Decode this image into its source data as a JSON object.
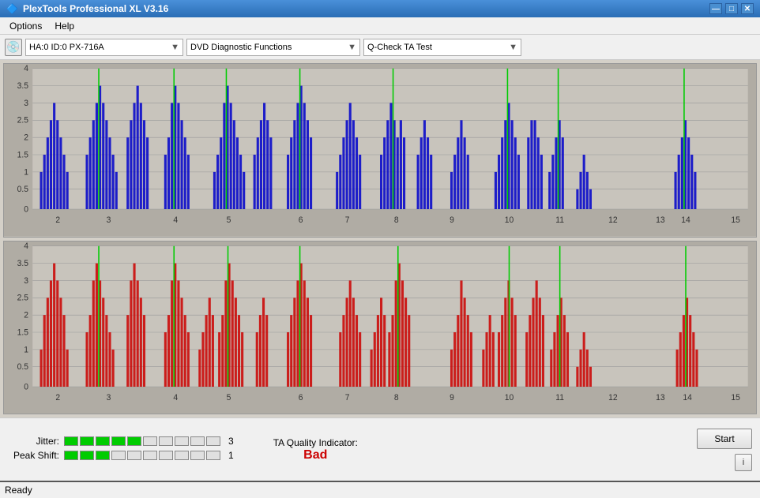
{
  "titlebar": {
    "title": "PlexTools Professional XL V3.16",
    "icon": "🔷",
    "minimize": "—",
    "maximize": "□",
    "close": "✕"
  },
  "menu": {
    "items": [
      "Options",
      "Help"
    ]
  },
  "toolbar": {
    "drive_icon": "💿",
    "drive_label": "HA:0 ID:0  PX-716A",
    "function_label": "DVD Diagnostic Functions",
    "test_label": "Q-Check TA Test"
  },
  "charts": {
    "top": {
      "y_max": 4,
      "y_labels": [
        "4",
        "3.5",
        "3",
        "2.5",
        "2",
        "1.5",
        "1",
        "0.5",
        "0"
      ],
      "x_labels": [
        "2",
        "3",
        "4",
        "5",
        "6",
        "7",
        "8",
        "9",
        "10",
        "11",
        "12",
        "13",
        "14",
        "15"
      ]
    },
    "bottom": {
      "y_max": 4,
      "y_labels": [
        "4",
        "3.5",
        "3",
        "2.5",
        "2",
        "1.5",
        "1",
        "0.5",
        "0"
      ],
      "x_labels": [
        "2",
        "3",
        "4",
        "5",
        "6",
        "7",
        "8",
        "9",
        "10",
        "11",
        "12",
        "13",
        "14",
        "15"
      ]
    }
  },
  "meters": {
    "jitter": {
      "label": "Jitter:",
      "filled": 5,
      "total": 10,
      "value": "3"
    },
    "peak_shift": {
      "label": "Peak Shift:",
      "filled": 3,
      "total": 10,
      "value": "1"
    }
  },
  "ta_quality": {
    "label": "TA Quality Indicator:",
    "value": "Bad"
  },
  "buttons": {
    "start": "Start",
    "info": "i"
  },
  "statusbar": {
    "text": "Ready"
  }
}
